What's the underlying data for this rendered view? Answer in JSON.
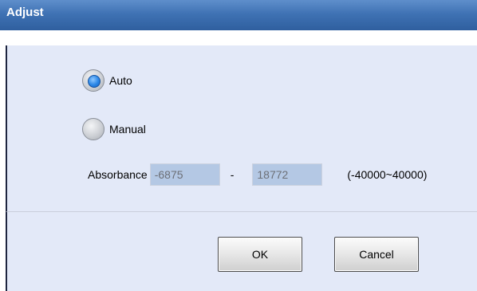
{
  "dialog": {
    "title": "Adjust"
  },
  "mode": {
    "options": [
      {
        "label": "Auto",
        "checked": true
      },
      {
        "label": "Manual",
        "checked": false
      }
    ]
  },
  "absorbance": {
    "label": "Absorbance",
    "min_value": "-6875",
    "separator": "-",
    "max_value": "18772",
    "range_hint": "(-40000~40000)"
  },
  "buttons": {
    "ok_label": "OK",
    "cancel_label": "Cancel"
  },
  "colors": {
    "titlebar": "#3f72b4",
    "panel": "#e3e9f8",
    "field": "#b4c8e4",
    "radio_selected": "#2a86e6"
  }
}
